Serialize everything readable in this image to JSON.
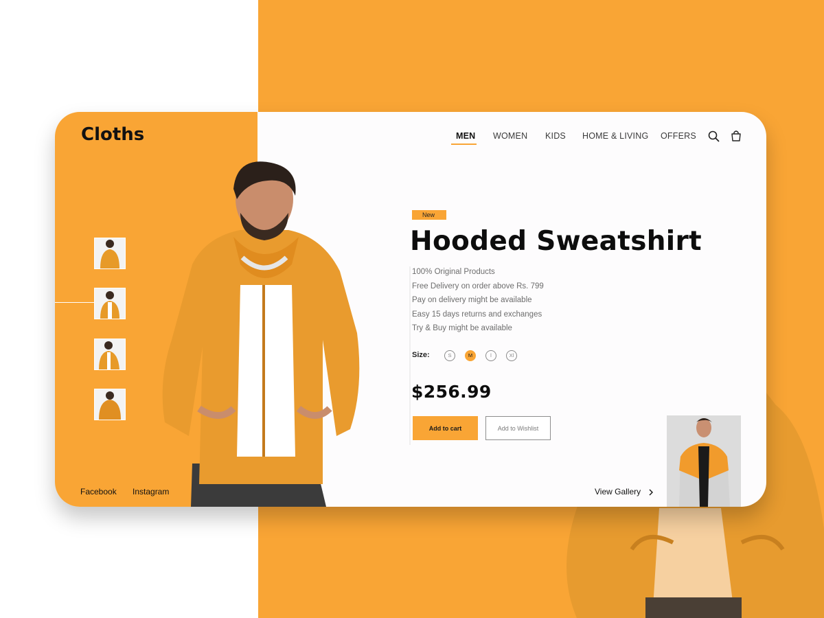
{
  "brand": {
    "name": "Cloths"
  },
  "nav": {
    "items": [
      {
        "label": "MEN",
        "active": true
      },
      {
        "label": "WOMEN",
        "active": false
      },
      {
        "label": "KIDS",
        "active": false
      },
      {
        "label": "HOME & LIVING",
        "active": false
      },
      {
        "label": "OFFERS",
        "active": false
      }
    ],
    "icons": [
      "search-icon",
      "shopping-bag-icon"
    ]
  },
  "thumbnails": {
    "count": 4,
    "selected_index": 1
  },
  "product": {
    "badge": "New",
    "title": "Hooded Sweatshirt",
    "features": [
      "100% Original Products",
      "Free Delivery on order above Rs. 799",
      "Pay on delivery might be available",
      "Easy 15 days returns and exchanges",
      "Try & Buy might be available"
    ],
    "size_label": "Size:",
    "sizes": [
      {
        "label": "S",
        "selected": false
      },
      {
        "label": "M",
        "selected": true
      },
      {
        "label": "l",
        "selected": false
      },
      {
        "label": "Xl",
        "selected": false
      }
    ],
    "price": "$256.99",
    "add_to_cart": "Add to cart",
    "add_to_wishlist": "Add to Wishlist"
  },
  "footer": {
    "social": [
      "Facebook",
      "Instagram"
    ],
    "view_gallery": "View Gallery"
  },
  "colors": {
    "accent": "#f9a535",
    "card_bg": "#fdfcfd",
    "text_dark": "#0d0d0d",
    "text_muted": "#6d6d6d"
  }
}
